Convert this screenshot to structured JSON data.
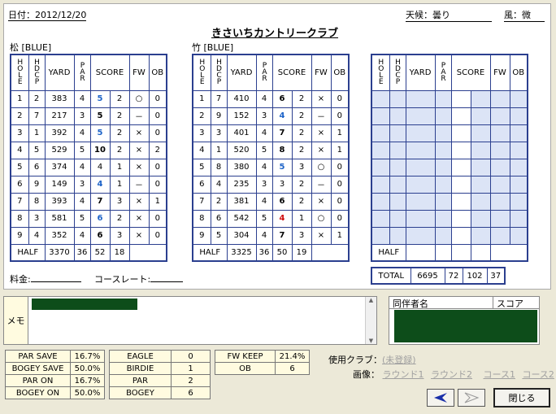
{
  "header": {
    "date_label": "日付：2012/12/20",
    "weather_label": "天候：曇り",
    "wind_label": "風：微",
    "club_name": "きさいちカントリークラブ"
  },
  "courses": [
    {
      "label": "松 [BLUE]",
      "headers": {
        "hole": "HOLE",
        "hdcp": "HDCP",
        "yard": "YARD",
        "par": "PAR",
        "score": "SCORE",
        "fw": "FW",
        "ob": "OB"
      },
      "rows": [
        {
          "hole": "1",
          "hdcp": "2",
          "yard": "383",
          "par": "4",
          "score": "5",
          "putt": "2",
          "fw": "○",
          "ob": "0",
          "color": "blue"
        },
        {
          "hole": "2",
          "hdcp": "7",
          "yard": "217",
          "par": "3",
          "score": "5",
          "putt": "2",
          "fw": "－",
          "ob": "0",
          "color": "black"
        },
        {
          "hole": "3",
          "hdcp": "1",
          "yard": "392",
          "par": "4",
          "score": "5",
          "putt": "2",
          "fw": "×",
          "ob": "0",
          "color": "blue"
        },
        {
          "hole": "4",
          "hdcp": "5",
          "yard": "529",
          "par": "5",
          "score": "10",
          "putt": "2",
          "fw": "×",
          "ob": "2",
          "color": "black"
        },
        {
          "hole": "5",
          "hdcp": "6",
          "yard": "374",
          "par": "4",
          "score": "4",
          "putt": "1",
          "fw": "×",
          "ob": "0",
          "color": "plain"
        },
        {
          "hole": "6",
          "hdcp": "9",
          "yard": "149",
          "par": "3",
          "score": "4",
          "putt": "1",
          "fw": "－",
          "ob": "0",
          "color": "blue"
        },
        {
          "hole": "7",
          "hdcp": "8",
          "yard": "393",
          "par": "4",
          "score": "7",
          "putt": "3",
          "fw": "×",
          "ob": "1",
          "color": "black"
        },
        {
          "hole": "8",
          "hdcp": "3",
          "yard": "581",
          "par": "5",
          "score": "6",
          "putt": "2",
          "fw": "×",
          "ob": "0",
          "color": "blue"
        },
        {
          "hole": "9",
          "hdcp": "4",
          "yard": "352",
          "par": "4",
          "score": "6",
          "putt": "3",
          "fw": "×",
          "ob": "0",
          "color": "black"
        }
      ],
      "half": {
        "label": "HALF",
        "yard": "3370",
        "par": "36",
        "score": "52",
        "putt": "18"
      }
    },
    {
      "label": "竹 [BLUE]",
      "headers": {
        "hole": "HOLE",
        "hdcp": "HDCP",
        "yard": "YARD",
        "par": "PAR",
        "score": "SCORE",
        "fw": "FW",
        "ob": "OB"
      },
      "rows": [
        {
          "hole": "1",
          "hdcp": "7",
          "yard": "410",
          "par": "4",
          "score": "6",
          "putt": "2",
          "fw": "×",
          "ob": "0",
          "color": "black"
        },
        {
          "hole": "2",
          "hdcp": "9",
          "yard": "152",
          "par": "3",
          "score": "4",
          "putt": "2",
          "fw": "－",
          "ob": "0",
          "color": "blue"
        },
        {
          "hole": "3",
          "hdcp": "3",
          "yard": "401",
          "par": "4",
          "score": "7",
          "putt": "2",
          "fw": "×",
          "ob": "1",
          "color": "black"
        },
        {
          "hole": "4",
          "hdcp": "1",
          "yard": "520",
          "par": "5",
          "score": "8",
          "putt": "2",
          "fw": "×",
          "ob": "1",
          "color": "black"
        },
        {
          "hole": "5",
          "hdcp": "8",
          "yard": "380",
          "par": "4",
          "score": "5",
          "putt": "3",
          "fw": "○",
          "ob": "0",
          "color": "blue"
        },
        {
          "hole": "6",
          "hdcp": "4",
          "yard": "235",
          "par": "3",
          "score": "3",
          "putt": "2",
          "fw": "－",
          "ob": "0",
          "color": "plain"
        },
        {
          "hole": "7",
          "hdcp": "2",
          "yard": "381",
          "par": "4",
          "score": "6",
          "putt": "2",
          "fw": "×",
          "ob": "0",
          "color": "black"
        },
        {
          "hole": "8",
          "hdcp": "6",
          "yard": "542",
          "par": "5",
          "score": "4",
          "putt": "1",
          "fw": "○",
          "ob": "0",
          "color": "red"
        },
        {
          "hole": "9",
          "hdcp": "5",
          "yard": "304",
          "par": "4",
          "score": "7",
          "putt": "3",
          "fw": "×",
          "ob": "1",
          "color": "black"
        }
      ],
      "half": {
        "label": "HALF",
        "yard": "3325",
        "par": "36",
        "score": "50",
        "putt": "19"
      }
    },
    {
      "label": "",
      "headers": {
        "hole": "HOLE",
        "hdcp": "HDCP",
        "yard": "YARD",
        "par": "PAR",
        "score": "SCORE",
        "fw": "FW",
        "ob": "OB"
      },
      "rows": [],
      "half": {
        "label": "HALF",
        "yard": "",
        "par": "",
        "score": "",
        "putt": ""
      }
    }
  ],
  "total": {
    "label": "TOTAL",
    "yard": "6695",
    "par": "72",
    "score": "102",
    "putt": "37"
  },
  "fee_label": "料金:",
  "course_rate_label": "コースレート:",
  "memo_label": "メモ",
  "partners": {
    "name_header": "同伴者名",
    "score_header": "スコア"
  },
  "stats_left": [
    {
      "label": "PAR SAVE",
      "value": "16.7%"
    },
    {
      "label": "BOGEY SAVE",
      "value": "50.0%"
    },
    {
      "label": "PAR ON",
      "value": "16.7%"
    },
    {
      "label": "BOGEY ON",
      "value": "50.0%"
    }
  ],
  "stats_mid": [
    {
      "label": "EAGLE",
      "value": "0"
    },
    {
      "label": "BIRDIE",
      "value": "1"
    },
    {
      "label": "PAR",
      "value": "2"
    },
    {
      "label": "BOGEY",
      "value": "6"
    }
  ],
  "stats_right": [
    {
      "label": "FW KEEP",
      "value": "21.4%"
    },
    {
      "label": "OB",
      "value": "6"
    }
  ],
  "club_used_label": "使用クラブ：",
  "club_unregistered": "(未登録)",
  "image_label": "画像：",
  "image_links": [
    "ラウンド1",
    "ラウンド2",
    "コース1",
    "コース2"
  ],
  "close_button": "閉じる",
  "colors": {
    "grid": "#2b3f8f",
    "cell_blue": "#dce4f6",
    "score_blue": "#1e64c8",
    "score_red": "#d01010",
    "redact": "#0d4d1a"
  }
}
